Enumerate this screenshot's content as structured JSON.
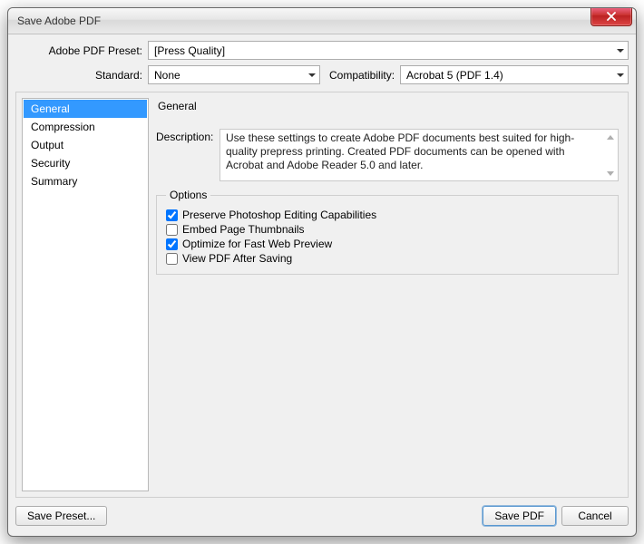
{
  "window": {
    "title": "Save Adobe PDF"
  },
  "top": {
    "preset_label": "Adobe PDF Preset:",
    "preset_value": "[Press Quality]",
    "standard_label": "Standard:",
    "standard_value": "None",
    "compat_label": "Compatibility:",
    "compat_value": "Acrobat 5 (PDF 1.4)"
  },
  "sidebar": {
    "items": [
      {
        "label": "General",
        "selected": true
      },
      {
        "label": "Compression",
        "selected": false
      },
      {
        "label": "Output",
        "selected": false
      },
      {
        "label": "Security",
        "selected": false
      },
      {
        "label": "Summary",
        "selected": false
      }
    ]
  },
  "content": {
    "heading": "General",
    "description_label": "Description:",
    "description_text": "Use these settings to create Adobe PDF documents best suited for high-quality prepress printing.  Created PDF documents can be opened with Acrobat and Adobe Reader 5.0 and later.",
    "options_legend": "Options",
    "options": [
      {
        "label": "Preserve Photoshop Editing Capabilities",
        "checked": true
      },
      {
        "label": "Embed Page Thumbnails",
        "checked": false
      },
      {
        "label": "Optimize for Fast Web Preview",
        "checked": true
      },
      {
        "label": "View PDF After Saving",
        "checked": false
      }
    ]
  },
  "buttons": {
    "save_preset": "Save Preset...",
    "save_pdf": "Save PDF",
    "cancel": "Cancel"
  }
}
